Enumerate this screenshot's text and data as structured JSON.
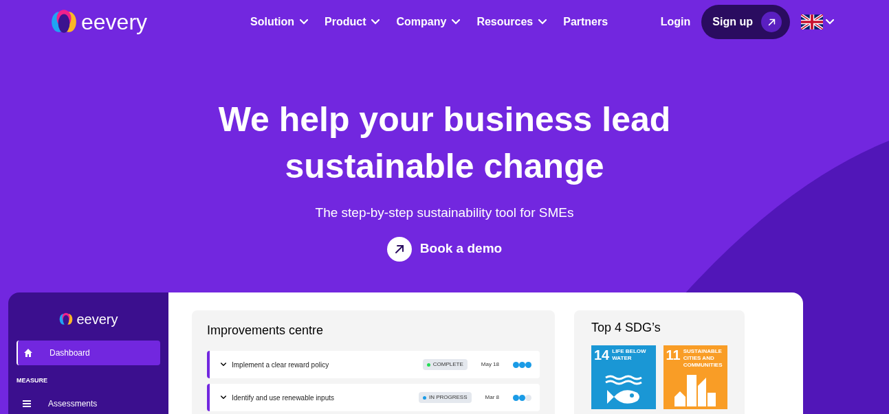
{
  "header": {
    "logo": "eevery",
    "nav": [
      {
        "label": "Solution",
        "dropdown": true
      },
      {
        "label": "Product",
        "dropdown": true
      },
      {
        "label": "Company",
        "dropdown": true
      },
      {
        "label": "Resources",
        "dropdown": true
      },
      {
        "label": "Partners",
        "dropdown": false
      }
    ],
    "login": "Login",
    "signup": "Sign up"
  },
  "hero": {
    "title_lines": [
      "We help your business lead",
      "sustainable change"
    ],
    "subtitle": "The step-by-step sustainability tool for SMEs",
    "cta": "Book a demo"
  },
  "dashboard": {
    "logo": "eevery",
    "sidebar": [
      {
        "kind": "item",
        "label": "Dashboard",
        "selected": true
      },
      {
        "kind": "section",
        "label": "MEASURE"
      },
      {
        "kind": "item",
        "label": "Assessments",
        "selected": false
      }
    ],
    "improvements": {
      "title": "Improvements centre",
      "items": [
        {
          "label": "Implement a clear reward policy",
          "status": "COMPLETE",
          "color": "#22dd55",
          "date": "May 18",
          "stars": 3
        },
        {
          "label": "Identify and use renewable inputs",
          "status": "IN PROGRESS",
          "color": "#1a9be6",
          "date": "Mar 8",
          "stars": 2
        }
      ]
    },
    "sdgs": {
      "title": "Top 4 SDG’s",
      "tiles": [
        {
          "kind": "water",
          "number": "14",
          "label": "LIFE BELOW WATER",
          "color": "#1a97d5"
        },
        {
          "kind": "city",
          "number": "11",
          "label": "SUSTAINABLE CITIES AND COMMUNITIES",
          "color": "#f99d26"
        }
      ]
    }
  }
}
